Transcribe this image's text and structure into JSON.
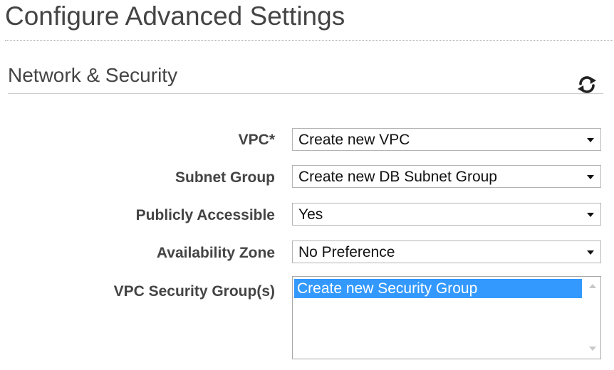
{
  "page": {
    "title": "Configure Advanced Settings"
  },
  "section": {
    "title": "Network & Security",
    "refresh_icon": "refresh-icon"
  },
  "fields": {
    "vpc": {
      "label": "VPC*",
      "value": "Create new VPC"
    },
    "subnet_group": {
      "label": "Subnet Group",
      "value": "Create new DB Subnet Group"
    },
    "publicly_accessible": {
      "label": "Publicly Accessible",
      "value": "Yes"
    },
    "availability_zone": {
      "label": "Availability Zone",
      "value": "No Preference"
    },
    "vpc_security_groups": {
      "label": "VPC Security Group(s)",
      "options": [
        "Create new Security Group"
      ],
      "selected": "Create new Security Group"
    }
  },
  "colors": {
    "selection": "#3399ff",
    "text": "#444444",
    "border": "#b4b4b4"
  }
}
